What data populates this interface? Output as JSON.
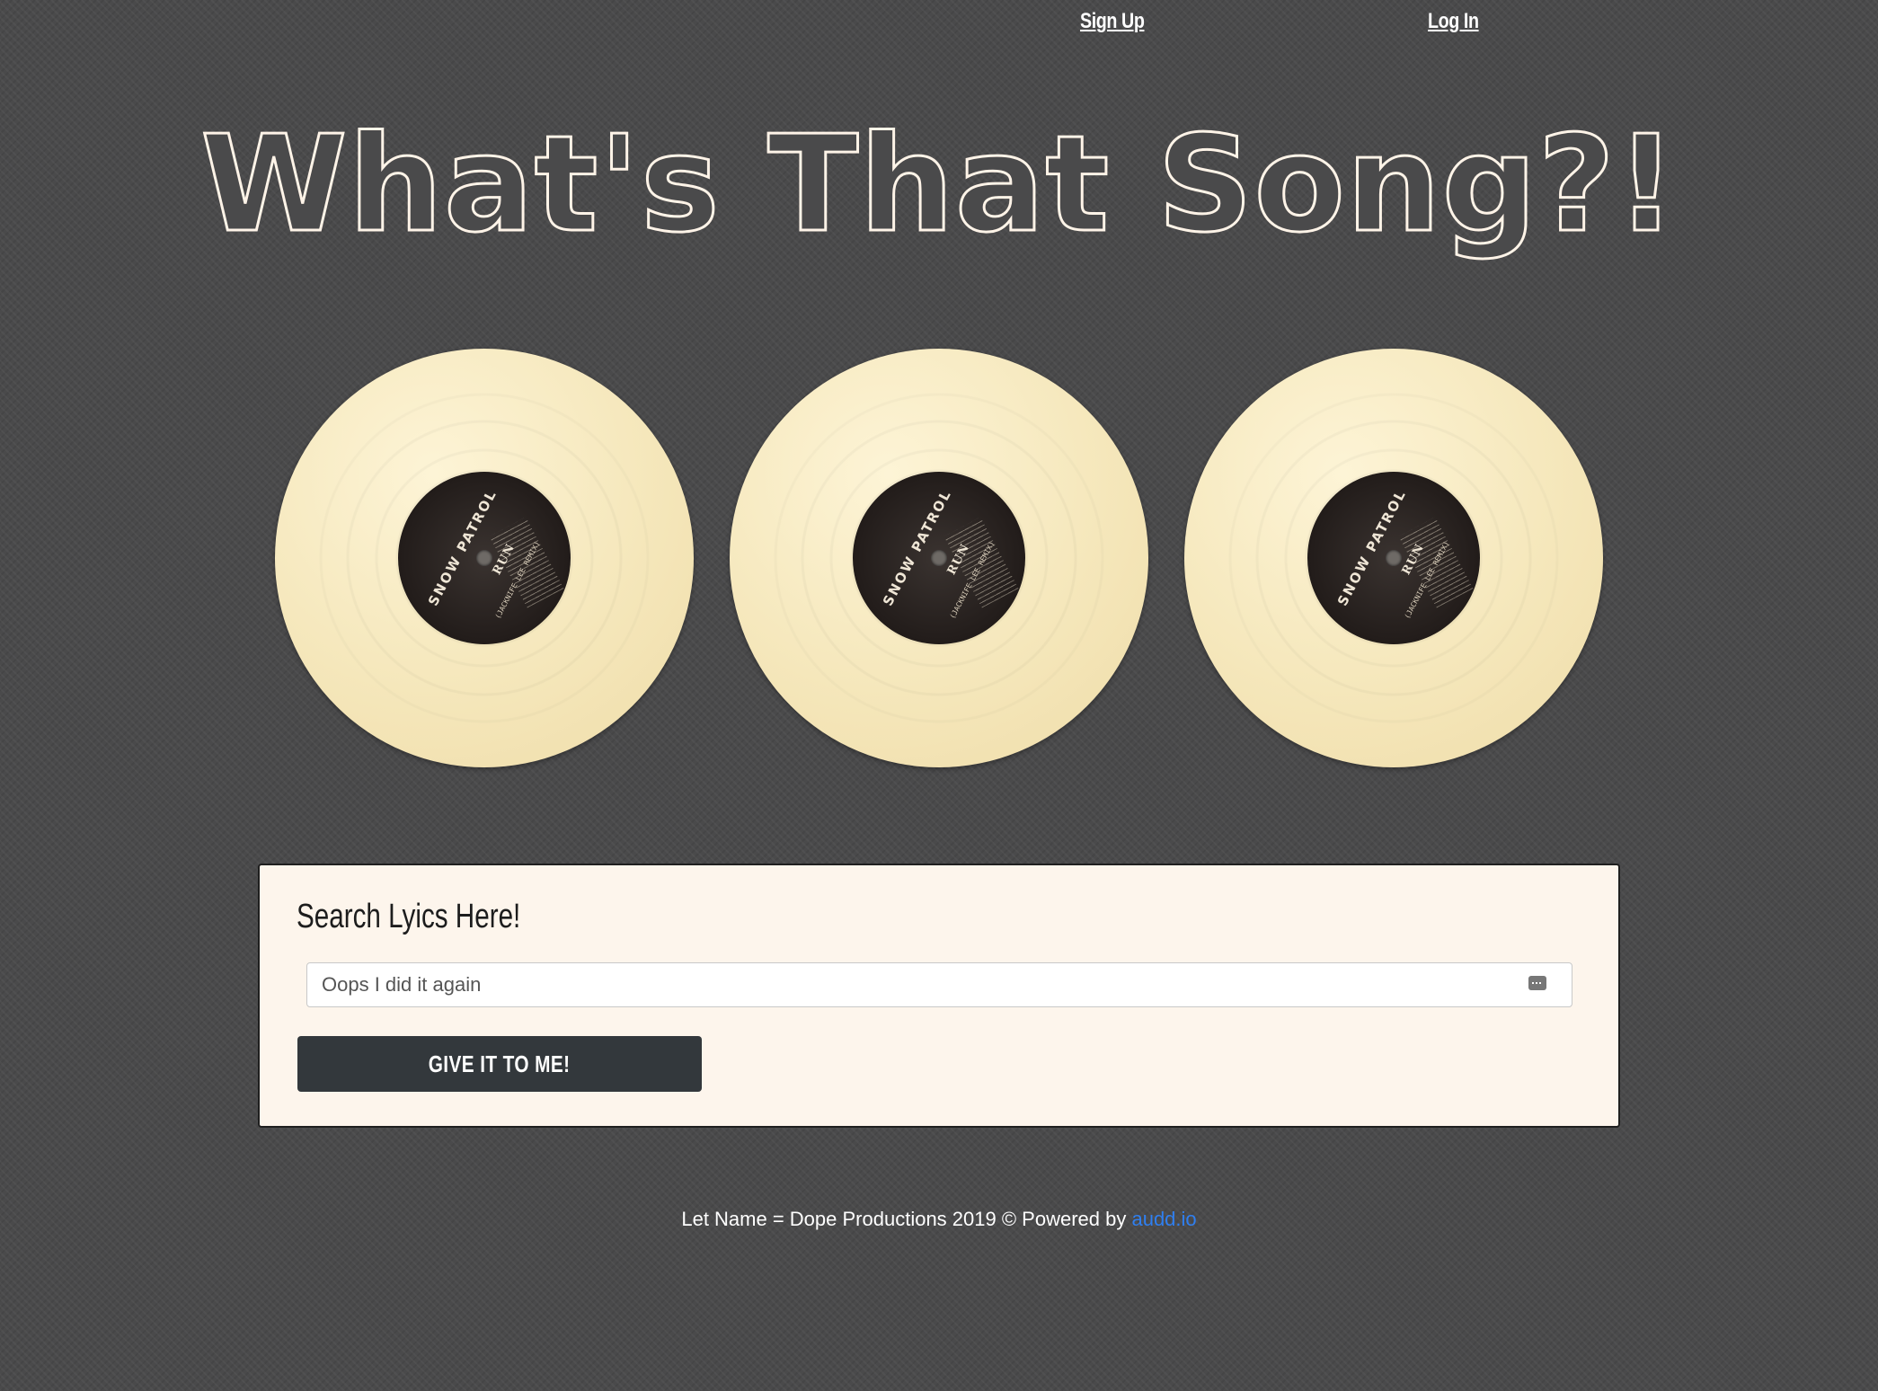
{
  "nav": {
    "signup_label": "Sign Up",
    "login_label": "Log In"
  },
  "header": {
    "title": "What's That Song?!"
  },
  "records": [
    {
      "artist": "SNOW PATROL",
      "song": "RUN",
      "sub": "(JACKNIFE LEE REMIX)"
    },
    {
      "artist": "SNOW PATROL",
      "song": "RUN",
      "sub": "(JACKNIFE LEE REMIX)"
    },
    {
      "artist": "SNOW PATROL",
      "song": "RUN",
      "sub": "(JACKNIFE LEE REMIX)"
    }
  ],
  "search": {
    "heading": "Search Lyics Here!",
    "placeholder": "Oops I did it again",
    "submit_label": "GIVE IT TO ME!"
  },
  "footer": {
    "text": "Let Name = Dope Productions 2019 © Powered by",
    "link_label": "audd.io"
  },
  "colors": {
    "background": "#4a4a4b",
    "card": "#fdf5ec",
    "button": "#33383c",
    "link": "#2f7ff0",
    "record": "#f5e7bb"
  }
}
